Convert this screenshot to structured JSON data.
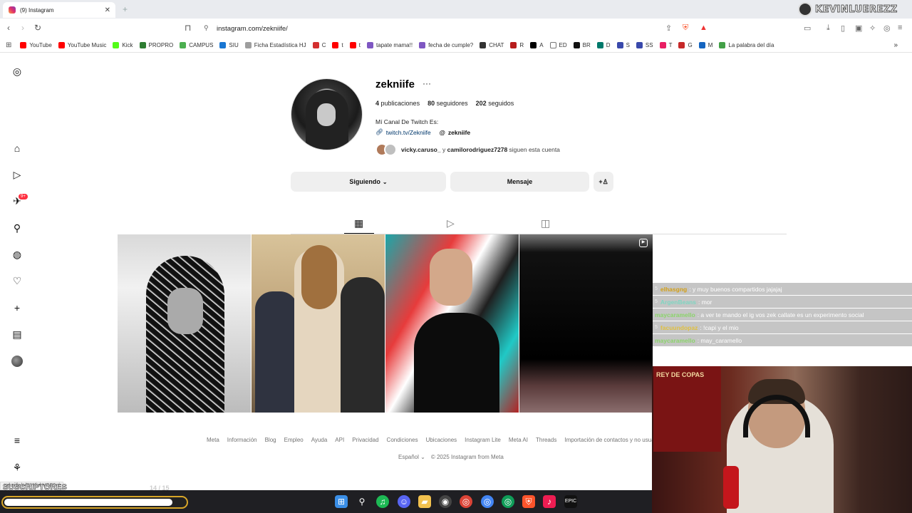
{
  "browser": {
    "tab_title": "(9) Instagram",
    "url": "instagram.com/zekniife/",
    "streamer_name": "KEVINLUEREZZ",
    "bookmarks": [
      {
        "label": "YouTube",
        "color": "#ff0000"
      },
      {
        "label": "YouTube Music",
        "color": "#ff0000"
      },
      {
        "label": "Kick",
        "color": "#53fc18"
      },
      {
        "label": "PROPRO",
        "color": "#2e7d32"
      },
      {
        "label": "CAMPUS",
        "color": "#4caf50"
      },
      {
        "label": "SIU",
        "color": "#1976d2"
      },
      {
        "label": "Ficha Estadística HJ",
        "color": "#9e9e9e"
      },
      {
        "label": "C",
        "color": "#d32f2f"
      },
      {
        "label": "t",
        "color": "#ff0000"
      },
      {
        "label": "t",
        "color": "#ff0000"
      },
      {
        "label": "tapate mama!!",
        "color": "#7e57c2"
      },
      {
        "label": "fecha de cumple?",
        "color": "#7e57c2"
      },
      {
        "label": "CHAT",
        "color": "#333333"
      },
      {
        "label": "R",
        "color": "#b71c1c"
      },
      {
        "label": "A",
        "color": "#000000"
      },
      {
        "label": "ED",
        "color": "#ffffff"
      },
      {
        "label": "BR",
        "color": "#111111"
      },
      {
        "label": "D",
        "color": "#00796b"
      },
      {
        "label": "S",
        "color": "#3949ab"
      },
      {
        "label": "SS",
        "color": "#3949ab"
      },
      {
        "label": "T",
        "color": "#e91e63"
      },
      {
        "label": "G",
        "color": "#c62828"
      },
      {
        "label": "M",
        "color": "#1565c0"
      },
      {
        "label": "La palabra del día",
        "color": "#43a047"
      }
    ]
  },
  "sidebar": {
    "notification_badge": "9+"
  },
  "profile": {
    "username": "zekniife",
    "more_icon": "···",
    "posts_count": "4",
    "posts_label": "publicaciones",
    "followers_count": "80",
    "followers_label": "seguidores",
    "following_count": "202",
    "following_label": "seguidos",
    "bio": "Mí Canal De Twitch Es:",
    "link": "twitch.tv/Zekniife",
    "threads_handle": "zekniife",
    "followed_by_1": "vicky.caruso_",
    "followed_by_join": "y",
    "followed_by_2": "camilorodriguez7278",
    "followed_by_suffix": "siguen esta cuenta",
    "following_button": "Siguiendo",
    "message_button": "Mensaje"
  },
  "footer": {
    "links": [
      "Meta",
      "Información",
      "Blog",
      "Empleo",
      "Ayuda",
      "API",
      "Privacidad",
      "Condiciones",
      "Ubicaciones",
      "Instagram Lite",
      "Meta AI",
      "Threads",
      "Importación de contactos y no usuarios"
    ],
    "language": "Español",
    "copyright": "© 2025 Instagram from Meta"
  },
  "chat": [
    {
      "badge": "5",
      "user": "elhasgng",
      "color": "#d4a017",
      "message": ": y muy buenos compartidos jajajaj"
    },
    {
      "badge": "5",
      "user": "ArgenBeans",
      "color": "#7fd6c2",
      "message": ": mor"
    },
    {
      "badge": "",
      "user": "maycaramello",
      "color": "#8bd46b",
      "message": ": a ver te mando el ig vos zek callate es un experimento social"
    },
    {
      "badge": "5",
      "user": "facuundopaz",
      "color": "#e0c040",
      "message": ": !capi y el mio"
    },
    {
      "badge": "",
      "user": "maycaramello",
      "color": "#8bd46b",
      "message": ": may_caramello"
    }
  ],
  "webcam": {
    "poster_text": "REY DE COPAS"
  },
  "overlay": {
    "status_url": "zekniife/p/DIWluhVOB9v/",
    "subs_label": "SUSCRIPTORES",
    "subs_count": "14 / 15",
    "subs_progress": 0.93
  }
}
